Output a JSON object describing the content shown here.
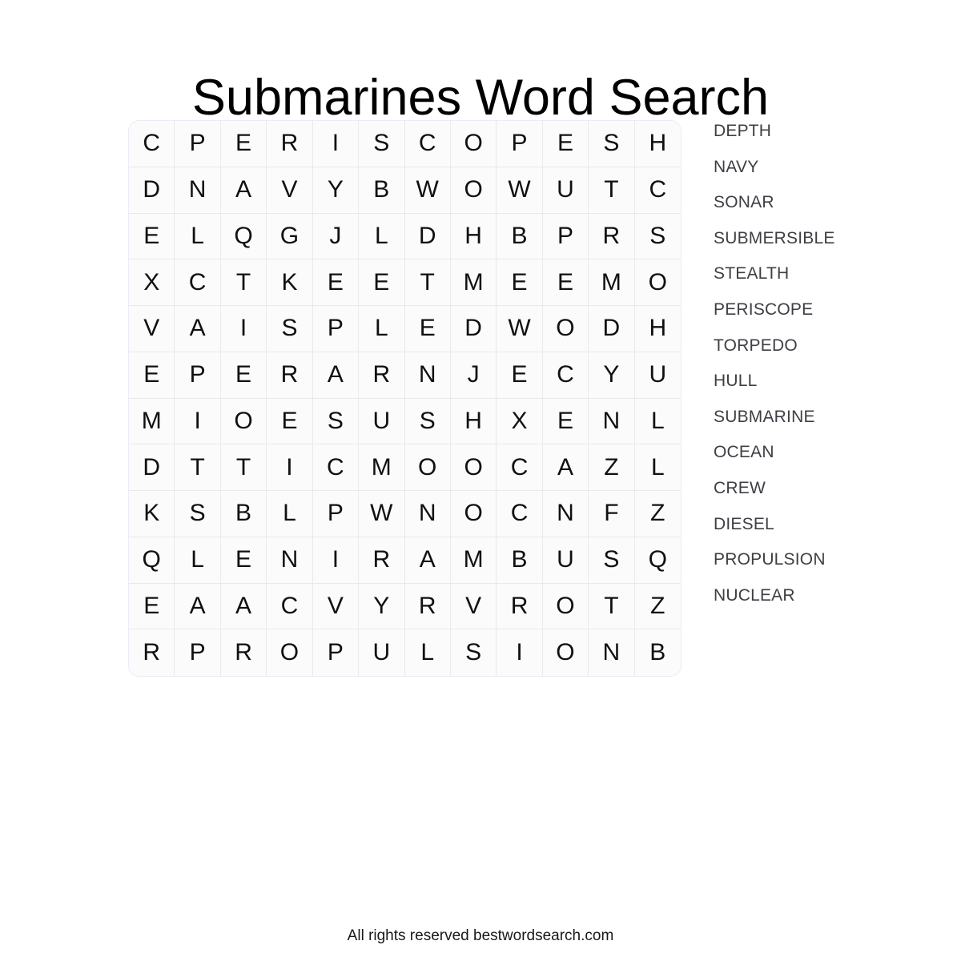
{
  "page": {
    "title": "Submarines Word Search",
    "footer": "All rights reserved bestwordsearch.com",
    "background_color": "#ffffff",
    "title_color": "#000000",
    "grid_cell_color": "#fbfbfc",
    "grid_border_color": "#e9e9ee",
    "word_text_color": "#3e3e44"
  },
  "grid": {
    "rows": 12,
    "cols": 12,
    "letters": [
      [
        "C",
        "P",
        "E",
        "R",
        "I",
        "S",
        "C",
        "O",
        "P",
        "E",
        "S",
        "H"
      ],
      [
        "D",
        "N",
        "A",
        "V",
        "Y",
        "B",
        "W",
        "O",
        "W",
        "U",
        "T",
        "C"
      ],
      [
        "E",
        "L",
        "Q",
        "G",
        "J",
        "L",
        "D",
        "H",
        "B",
        "P",
        "R",
        "S"
      ],
      [
        "X",
        "C",
        "T",
        "K",
        "E",
        "E",
        "T",
        "M",
        "E",
        "E",
        "M",
        "O"
      ],
      [
        "V",
        "A",
        "I",
        "S",
        "P",
        "L",
        "E",
        "D",
        "W",
        "O",
        "D",
        "H"
      ],
      [
        "E",
        "P",
        "E",
        "R",
        "A",
        "R",
        "N",
        "J",
        "E",
        "C",
        "Y",
        "U"
      ],
      [
        "M",
        "I",
        "O",
        "E",
        "S",
        "U",
        "S",
        "H",
        "X",
        "E",
        "N",
        "L"
      ],
      [
        "D",
        "T",
        "T",
        "I",
        "C",
        "M",
        "O",
        "O",
        "C",
        "A",
        "Z",
        "L"
      ],
      [
        "K",
        "S",
        "B",
        "L",
        "P",
        "W",
        "N",
        "O",
        "C",
        "N",
        "F",
        "Z"
      ],
      [
        "Q",
        "L",
        "E",
        "N",
        "I",
        "R",
        "A",
        "M",
        "B",
        "U",
        "S",
        "Q"
      ],
      [
        "E",
        "A",
        "A",
        "C",
        "V",
        "Y",
        "R",
        "V",
        "R",
        "O",
        "T",
        "Z"
      ],
      [
        "R",
        "P",
        "R",
        "O",
        "P",
        "U",
        "L",
        "S",
        "I",
        "O",
        "N",
        "B"
      ]
    ]
  },
  "words": [
    "DEPTH",
    "NAVY",
    "SONAR",
    "SUBMERSIBLE",
    "STEALTH",
    "PERISCOPE",
    "TORPEDO",
    "HULL",
    "SUBMARINE",
    "OCEAN",
    "CREW",
    "DIESEL",
    "PROPULSION",
    "NUCLEAR"
  ]
}
